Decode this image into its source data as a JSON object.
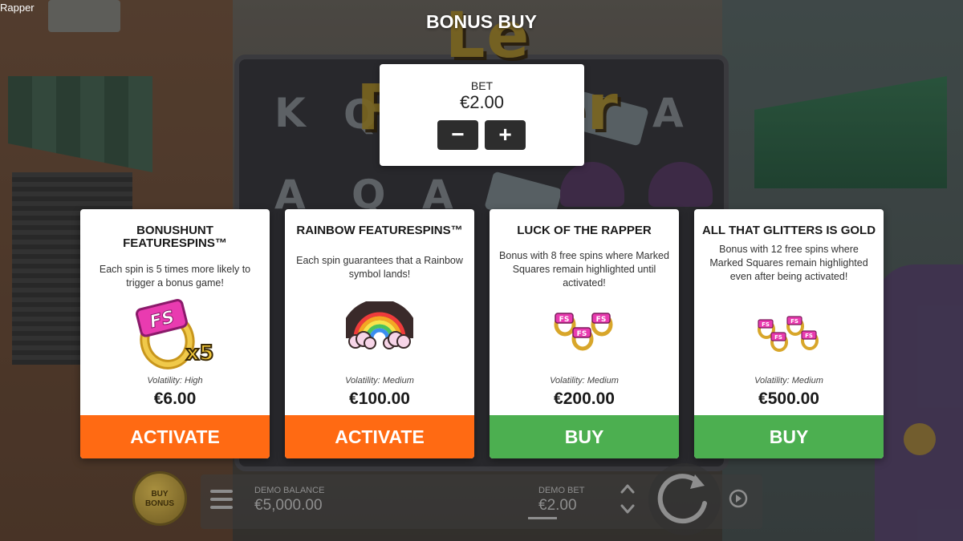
{
  "window_title": "Rapper",
  "game_logo": "Le Rapper",
  "bonus_buy": {
    "title": "BONUS BUY",
    "bet_label": "BET",
    "bet_value": "€2.00",
    "minus_symbol": "−",
    "plus_symbol": "+"
  },
  "cards": [
    {
      "title": "BONUSHUNT FEATURESPINS™",
      "description": "Each spin is 5 times more likely to trigger a bonus game!",
      "icon": "fs-ring-x5-icon",
      "art_text": "x5",
      "volatility": "Volatility: High",
      "price": "€6.00",
      "button": "ACTIVATE",
      "button_color": "#ff6a13"
    },
    {
      "title": "RAINBOW FEATURESPINS™",
      "description": "Each spin guarantees that a Rainbow symbol lands!",
      "icon": "rainbow-icon",
      "volatility": "Volatility: Medium",
      "price": "€100.00",
      "button": "ACTIVATE",
      "button_color": "#ff6a13"
    },
    {
      "title": "LUCK OF THE RAPPER",
      "description": "Bonus with 8 free spins where Marked Squares remain highlighted until activated!",
      "icon": "three-fs-rings-icon",
      "volatility": "Volatility: Medium",
      "price": "€200.00",
      "button": "BUY",
      "button_color": "#4caf50"
    },
    {
      "title": "ALL THAT GLITTERS IS GOLD",
      "description": "Bonus with 12 free spins where Marked Squares remain highlighted even after being activated!",
      "icon": "four-fs-rings-icon",
      "volatility": "Volatility: Medium",
      "price": "€500.00",
      "button": "BUY",
      "button_color": "#4caf50"
    }
  ],
  "bottom_bar": {
    "buy_bonus_line1": "BUY",
    "buy_bonus_line2": "BONUS",
    "balance_label": "DEMO BALANCE",
    "balance_value": "€5,000.00",
    "bet_label": "DEMO BET",
    "bet_value": "€2.00"
  },
  "colors": {
    "activate_orange": "#ff6a13",
    "buy_green": "#4caf50",
    "ring_gold": "#e2b82a",
    "fs_pink": "#e93bb0"
  }
}
